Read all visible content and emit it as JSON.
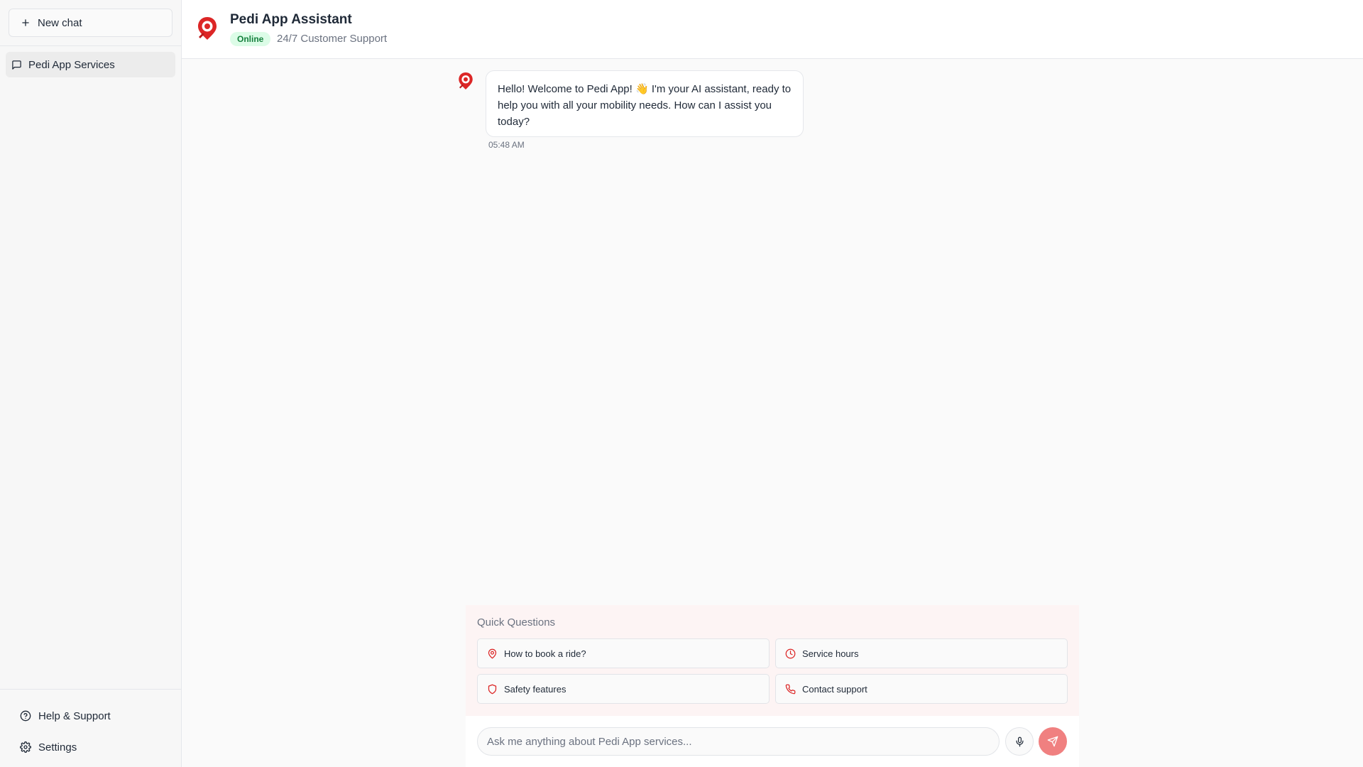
{
  "sidebar": {
    "new_chat_label": "New chat",
    "chats": [
      {
        "label": "Pedi App Services",
        "icon": "message-square-icon"
      }
    ],
    "bottom": {
      "help_label": "Help & Support",
      "settings_label": "Settings"
    }
  },
  "header": {
    "title": "Pedi App Assistant",
    "status": "Online",
    "subtitle": "24/7 Customer Support",
    "logo": "map-pin-logo"
  },
  "messages": [
    {
      "role": "assistant",
      "text": "Hello! Welcome to Pedi App! 👋 I'm your AI assistant, ready to help you with all your mobility needs. How can I assist you today?",
      "time": "05:48 AM"
    }
  ],
  "quick_questions": {
    "title": "Quick Questions",
    "items": [
      {
        "label": "How to book a ride?",
        "icon": "map-pin-icon"
      },
      {
        "label": "Service hours",
        "icon": "clock-icon"
      },
      {
        "label": "Safety features",
        "icon": "shield-icon"
      },
      {
        "label": "Contact support",
        "icon": "phone-icon"
      }
    ]
  },
  "composer": {
    "placeholder": "Ask me anything about Pedi App services..."
  },
  "colors": {
    "brand_red": "#dc2626",
    "online_bg": "#dcfce7",
    "online_text": "#15803d",
    "send_button": "#f08080",
    "quick_panel_bg": "#fdf4f4"
  }
}
